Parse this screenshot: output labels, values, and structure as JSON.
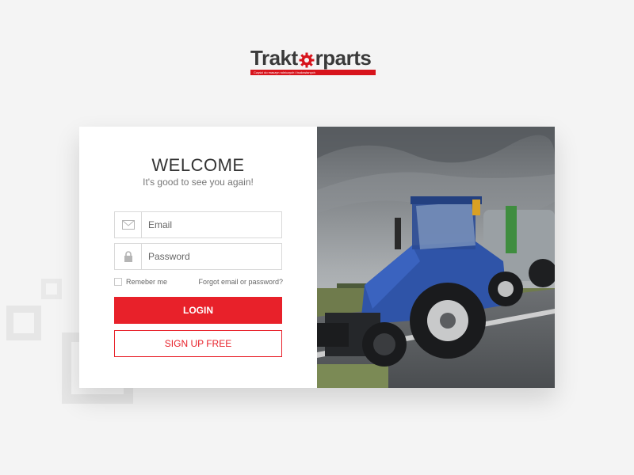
{
  "brand": {
    "name_part1": "Trakt",
    "name_part2": "rparts",
    "tagline": "Części do maszyn rolniczych i budowlanych",
    "accent_color": "#d7141c"
  },
  "login": {
    "title": "WELCOME",
    "subtitle": "It's good to see you again!",
    "email_placeholder": "Email",
    "password_placeholder": "Password",
    "remember_label": "Remeber me",
    "forgot_link": "Forgot email or password?",
    "login_button": "LOGIN",
    "signup_button": "SIGN UP FREE",
    "primary_color": "#e8212a"
  },
  "icons": {
    "email": "envelope-icon",
    "password": "lock-icon",
    "logo_gear": "gear-icon"
  }
}
